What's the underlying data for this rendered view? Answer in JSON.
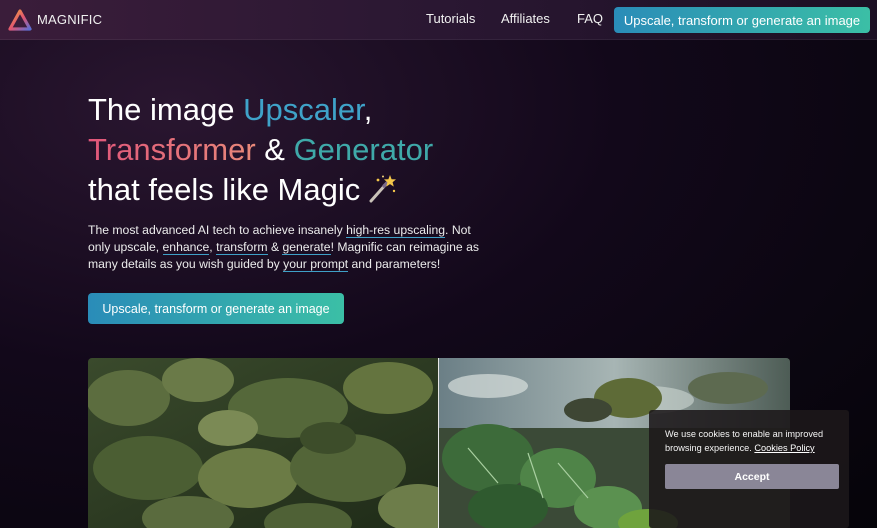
{
  "header": {
    "brand": "MAGNIFIC",
    "nav": {
      "tutorials": "Tutorials",
      "affiliates": "Affiliates",
      "faq": "FAQ"
    },
    "cta": "Upscale, transform or generate an image",
    "logo_icon": "triangle-logo-icon"
  },
  "hero": {
    "title": {
      "l1_a": "The image ",
      "l1_b": "Upscaler",
      "l1_c": ",",
      "l2_a": "Transformer",
      "l2_b": " & ",
      "l2_c": "Generator",
      "l3": "that feels like Magic",
      "icon": "magic-wand-icon"
    },
    "description": {
      "p1": "The most advanced AI tech to achieve insanely ",
      "link1": "high-res upscaling",
      "p2": ". Not only upscale, ",
      "link2": "enhance",
      "p3": ", ",
      "link3": "transform",
      "p4": " & ",
      "link4": "generate",
      "p5": "! Magnific can reimagine as many details as you wish guided by ",
      "link5": "your prompt",
      "p6": " and parameters!"
    },
    "cta": "Upscale, transform or generate an image"
  },
  "compare": {
    "left": "before-image",
    "right": "after-image"
  },
  "cookie": {
    "text": "We use cookies to enable an improved browsing experience.",
    "link": "Cookies Policy",
    "accept": "Accept"
  },
  "colors": {
    "accent_start": "#2a8cb8",
    "accent_end": "#3bbfa6",
    "blue_text": "#3fa3c9",
    "pink_text": "#e0567a",
    "background": "#0a0610"
  }
}
